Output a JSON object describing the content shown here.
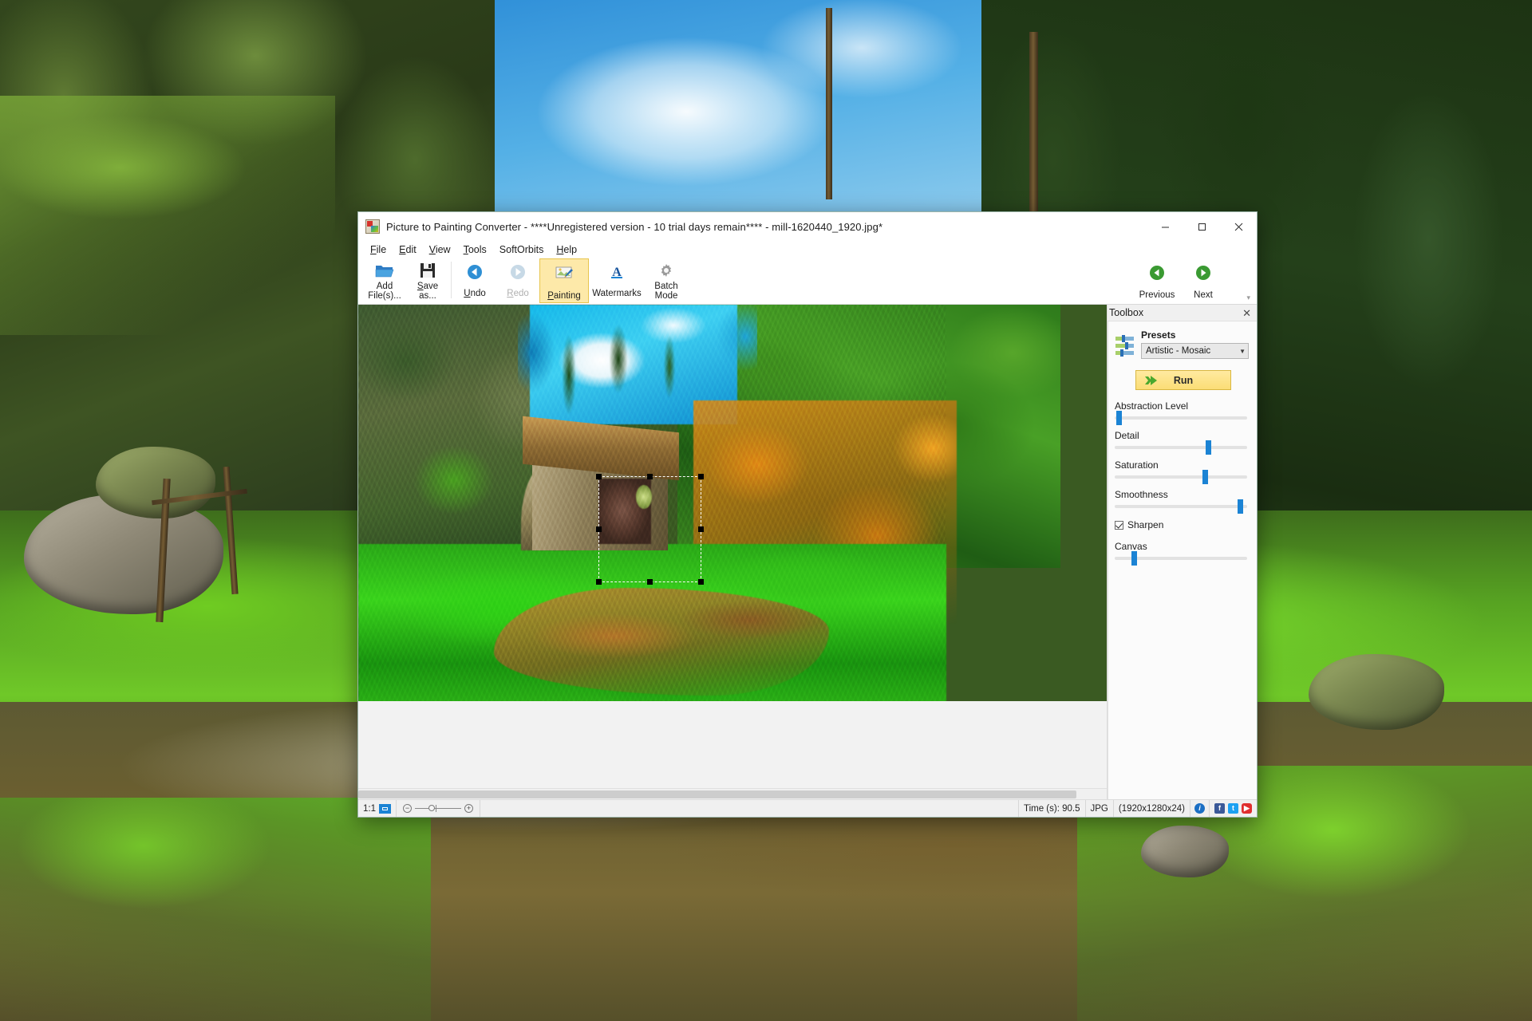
{
  "window": {
    "app_icon": "app-easel-icon",
    "title": "Picture to Painting Converter - ****Unregistered version - 10 trial days remain**** - mill-1620440_1920.jpg*",
    "controls": {
      "minimize": "minimize-icon",
      "maximize": "maximize-icon",
      "close": "close-icon"
    }
  },
  "menubar": {
    "items": [
      {
        "label": "File",
        "accel": "F"
      },
      {
        "label": "Edit",
        "accel": "E"
      },
      {
        "label": "View",
        "accel": "V"
      },
      {
        "label": "Tools",
        "accel": "T"
      },
      {
        "label": "SoftOrbits",
        "accel": ""
      },
      {
        "label": "Help",
        "accel": "H"
      }
    ]
  },
  "ribbon": {
    "buttons": [
      {
        "name": "add-files",
        "line1": "Add",
        "line2": "File(s)...",
        "icon": "open-folder-icon",
        "state": "normal"
      },
      {
        "name": "save-as",
        "line1": "Save",
        "line2": "as...",
        "icon": "floppy-disk-icon",
        "state": "normal"
      },
      {
        "name": "undo",
        "line1": "Undo",
        "line2": "",
        "icon": "undo-arrow-icon",
        "state": "normal"
      },
      {
        "name": "redo",
        "line1": "Redo",
        "line2": "",
        "icon": "redo-arrow-icon",
        "state": "disabled"
      },
      {
        "name": "painting",
        "line1": "Painting",
        "line2": "",
        "icon": "painting-icon",
        "state": "active"
      },
      {
        "name": "watermarks",
        "line1": "Watermarks",
        "line2": "",
        "icon": "letter-a-icon",
        "state": "normal"
      },
      {
        "name": "batch-mode",
        "line1": "Batch",
        "line2": "Mode",
        "icon": "gear-icon",
        "state": "normal"
      }
    ],
    "nav": [
      {
        "name": "previous",
        "label": "Previous",
        "icon": "green-left-arrow-icon"
      },
      {
        "name": "next",
        "label": "Next",
        "icon": "green-right-arrow-icon"
      }
    ],
    "expand": "ribbon-expand-chevron"
  },
  "toolbox": {
    "header": "Toolbox",
    "close": "close-icon",
    "presets_icon": "sliders-equalizer-icon",
    "presets_label": "Presets",
    "preset_selected": "Artistic - Mosaic",
    "preset_options": [
      "Artistic - Mosaic"
    ],
    "run_label": "Run",
    "run_icon": "green-double-arrow-icon",
    "sliders": [
      {
        "label": "Abstraction Level",
        "value": 1
      },
      {
        "label": "Detail",
        "value": 72
      },
      {
        "label": "Saturation",
        "value": 69
      },
      {
        "label": "Smoothness",
        "value": 97
      },
      {
        "label": "Canvas",
        "value": 13
      }
    ],
    "sharpen": {
      "label": "Sharpen",
      "checked": true
    }
  },
  "statusbar": {
    "zoom_ratio": "1:1",
    "fit_icon": "fit-to-window-icon",
    "zoom_out_icon": "zoom-out-icon",
    "zoom_in_icon": "zoom-in-icon",
    "time": "Time (s): 90.5",
    "format": "JPG",
    "dimensions": "(1920x1280x24)",
    "info_icon": "info-icon",
    "facebook_icon": "facebook-icon",
    "twitter_icon": "twitter-icon",
    "youtube_icon": "youtube-icon",
    "info_glyph": "i",
    "facebook_glyph": "f",
    "twitter_glyph": "t",
    "youtube_glyph": "▶"
  },
  "canvas": {
    "image_name": "painterly-mill-preview",
    "selection": "selection-marquee"
  },
  "colors": {
    "accent_blue": "#1b83d4",
    "run_yellow": "#fbdd76",
    "active_tab": "#fde9a9",
    "window_bg": "#f0f0f0",
    "nav_green": "#3a9a32"
  }
}
